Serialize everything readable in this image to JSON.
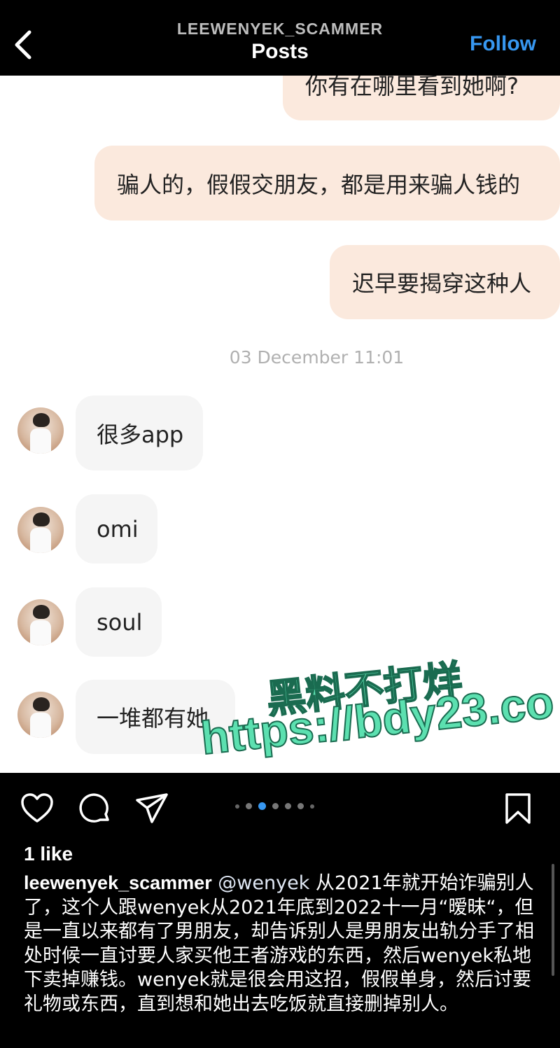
{
  "header": {
    "username": "LEEWENYEK_SCAMMER",
    "title": "Posts",
    "follow_label": "Follow",
    "back_icon": "chevron-left-icon",
    "follow_color": "#3797f0"
  },
  "chat": {
    "outgoing": [
      {
        "text": "你有在哪里看到她啊?"
      },
      {
        "text": "骗人的，假假交朋友，都是用来骗人钱的"
      },
      {
        "text": "迟早要揭穿这种人"
      }
    ],
    "timestamp": "03 December 11:01",
    "incoming": [
      {
        "text": "很多app"
      },
      {
        "text": "omi"
      },
      {
        "text": "soul"
      },
      {
        "text": "一堆都有她"
      }
    ],
    "outgoing_bubble_color": "#fbe9dd",
    "incoming_bubble_color": "#f5f5f5"
  },
  "watermark": {
    "line1": "黑料不打烊",
    "line2": "https://bdy23.co"
  },
  "post": {
    "icons": [
      "heart-icon",
      "comment-icon",
      "share-icon",
      "bookmark-icon"
    ],
    "carousel": {
      "count": 7,
      "active_index": 2
    },
    "likes": "1 like",
    "caption_user": "leewenyek_scammer",
    "caption_mention": "@wenyek",
    "caption_text": " 从2021年就开始诈骗别人了，这个人跟wenyek从2021年底到2022十一月“暧昧“，但是一直以来都有了男朋友，却告诉别人是男朋友出轨分手了相处时候一直讨要人家买他王者游戏的东西，然后wenyek私地下卖掉赚钱。wenyek就是很会用这招，假假单身，然后讨要礼物或东西，直到想和她出去吃饭就直接删掉别人。"
  }
}
